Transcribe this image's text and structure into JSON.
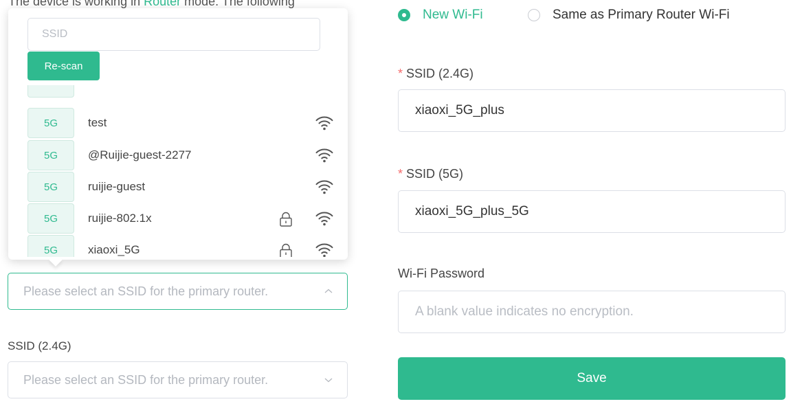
{
  "colors": {
    "accent": "#2fba8f",
    "tag_bg": "#eaf7f3",
    "tag_border": "#cfe9e0"
  },
  "background_text": {
    "before": "The device is working in ",
    "highlight": "Router",
    "after": " mode. The following"
  },
  "dropdown": {
    "search_placeholder": "SSID",
    "rescan_label": "Re-scan",
    "networks": [
      {
        "band": "5G",
        "name": "test",
        "locked": false
      },
      {
        "band": "5G",
        "name": "@Ruijie-guest-2277",
        "locked": false
      },
      {
        "band": "5G",
        "name": "ruijie-guest",
        "locked": false
      },
      {
        "band": "5G",
        "name": "ruijie-802.1x",
        "locked": true
      },
      {
        "band": "5G",
        "name": "xiaoxi_5G",
        "locked": true
      }
    ]
  },
  "primary_select": {
    "placeholder": "Please select an SSID for the primary router."
  },
  "left_ssid24": {
    "label": "SSID (2.4G)",
    "placeholder": "Please select an SSID for the primary router."
  },
  "wifi_mode": {
    "selected": "new",
    "option_new": "New Wi-Fi",
    "option_same": "Same as Primary Router Wi-Fi"
  },
  "form": {
    "ssid24_label": "SSID (2.4G)",
    "ssid24_value": "xiaoxi_5G_plus",
    "ssid5_label": "SSID (5G)",
    "ssid5_value": "xiaoxi_5G_plus_5G",
    "password_label": "Wi-Fi Password",
    "password_placeholder": "A blank value indicates no encryption.",
    "required_mark": "*",
    "save_label": "Save"
  }
}
